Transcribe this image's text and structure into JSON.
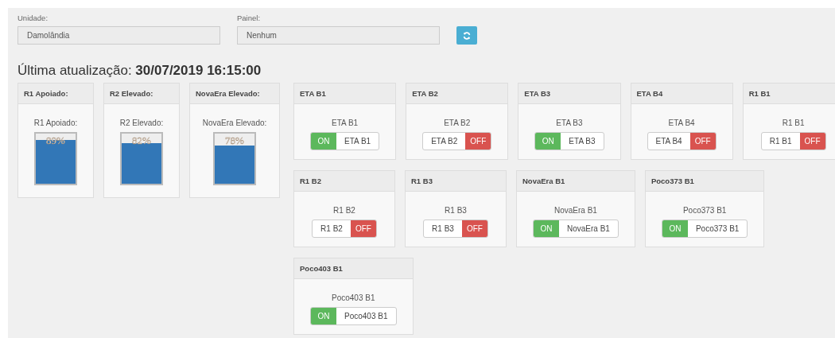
{
  "filters": [
    {
      "label": "Unidade:",
      "value": "Damolândia"
    },
    {
      "label": "Painel:",
      "value": "Nenhum"
    }
  ],
  "last_update": "Última atualização: **30/07/2019 16:15:00**",
  "tanks": [
    {
      "title": "R1 Apoiado:",
      "label": "R1 Apoiado:",
      "reading": "89%",
      "level": 0.87
    },
    {
      "title": "R2 Elevado:",
      "label": "R2 Elevado:",
      "reading": "82%",
      "level": 0.81
    },
    {
      "title": "NovaEra Elevado:",
      "label": "NovaEra Elevado:",
      "reading": "78%",
      "level": 0.76
    }
  ],
  "pumps": [
    {
      "title": "ETA B1",
      "label": "ETA B1",
      "switch_label": "ETA B1",
      "state": "ON",
      "on": true
    },
    {
      "title": "ETA B2",
      "label": "ETA B2",
      "switch_label": "ETA B2",
      "state": "OFF",
      "on": false
    },
    {
      "title": "ETA B3",
      "label": "ETA B3",
      "switch_label": "ETA B3",
      "state": "ON",
      "on": true
    },
    {
      "title": "ETA B4",
      "label": "ETA B4",
      "switch_label": "ETA B4",
      "state": "OFF",
      "on": false
    },
    {
      "title": "R1 B1",
      "label": "R1 B1",
      "switch_label": "R1 B1",
      "state": "OFF",
      "on": false
    },
    {
      "title": "R1 B2",
      "label": "R1 B2",
      "switch_label": "R1 B2",
      "state": "OFF",
      "on": false
    },
    {
      "title": "R1 B3",
      "label": "R1 B3",
      "switch_label": "R1 B3",
      "state": "OFF",
      "on": false
    },
    {
      "title": "NovaEra B1",
      "label": "NovaEra B1",
      "switch_label": "NovaEra B1",
      "state": "ON",
      "on": true
    },
    {
      "title": "Poco373 B1",
      "label": "Poco373 B1",
      "switch_label": "Poco373 B1",
      "state": "ON",
      "on": true
    },
    {
      "title": "Poco403 B1",
      "label": "Poco403 B1",
      "switch_label": "Poco403 B1",
      "state": "ON",
      "on": true
    }
  ]
}
